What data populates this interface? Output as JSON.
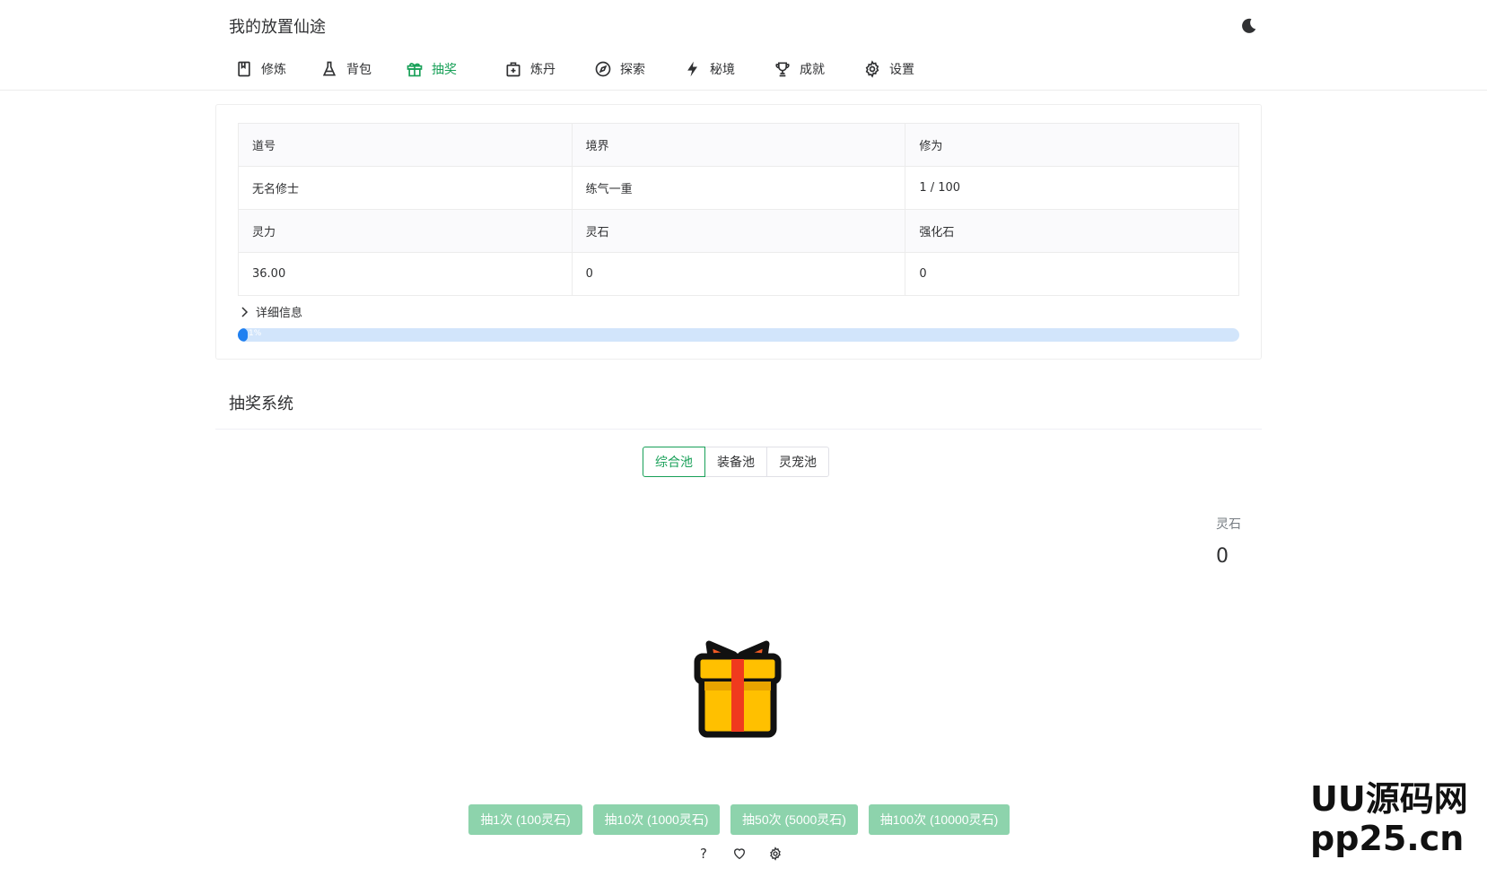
{
  "app": {
    "title": "我的放置仙途",
    "theme_icon": "moon-icon"
  },
  "nav": {
    "items": [
      {
        "label": "修炼",
        "icon": "book-icon"
      },
      {
        "label": "背包",
        "icon": "flask-icon"
      },
      {
        "label": "抽奖",
        "icon": "gift-icon",
        "active": true
      },
      {
        "label": "炼丹",
        "icon": "medkit-icon"
      },
      {
        "label": "探索",
        "icon": "compass-icon"
      },
      {
        "label": "秘境",
        "icon": "lightning-icon"
      },
      {
        "label": "成就",
        "icon": "trophy-icon"
      },
      {
        "label": "设置",
        "icon": "gear-icon"
      }
    ]
  },
  "stats": {
    "rows": [
      [
        "道号",
        "境界",
        "修为"
      ],
      [
        "无名修士",
        "练气一重",
        "1 / 100"
      ],
      [
        "灵力",
        "灵石",
        "强化石"
      ],
      [
        "36.00",
        "0",
        "0"
      ]
    ],
    "details_label": "详细信息",
    "progress_percent": 1,
    "progress_text": "1%"
  },
  "gacha": {
    "title": "抽奖系统",
    "pools": [
      {
        "label": "综合池",
        "active": true
      },
      {
        "label": "装备池"
      },
      {
        "label": "灵宠池"
      }
    ],
    "stone_label": "灵石",
    "stone_value": "0",
    "gift_icon": "gift-box-icon",
    "buttons": [
      "抽1次 (100灵石)",
      "抽10次 (1000灵石)",
      "抽50次 (5000灵石)",
      "抽100次 (10000灵石)"
    ],
    "footer_icons": [
      "question-icon",
      "heart-icon",
      "gear-icon"
    ]
  },
  "watermark": {
    "line1": "UU源码网",
    "line2": "pp25.cn"
  },
  "colors": {
    "accent": "#18a058",
    "button": "#8dd3ac",
    "progress": "#2080f0",
    "progress_track": "#d2e5fb"
  }
}
